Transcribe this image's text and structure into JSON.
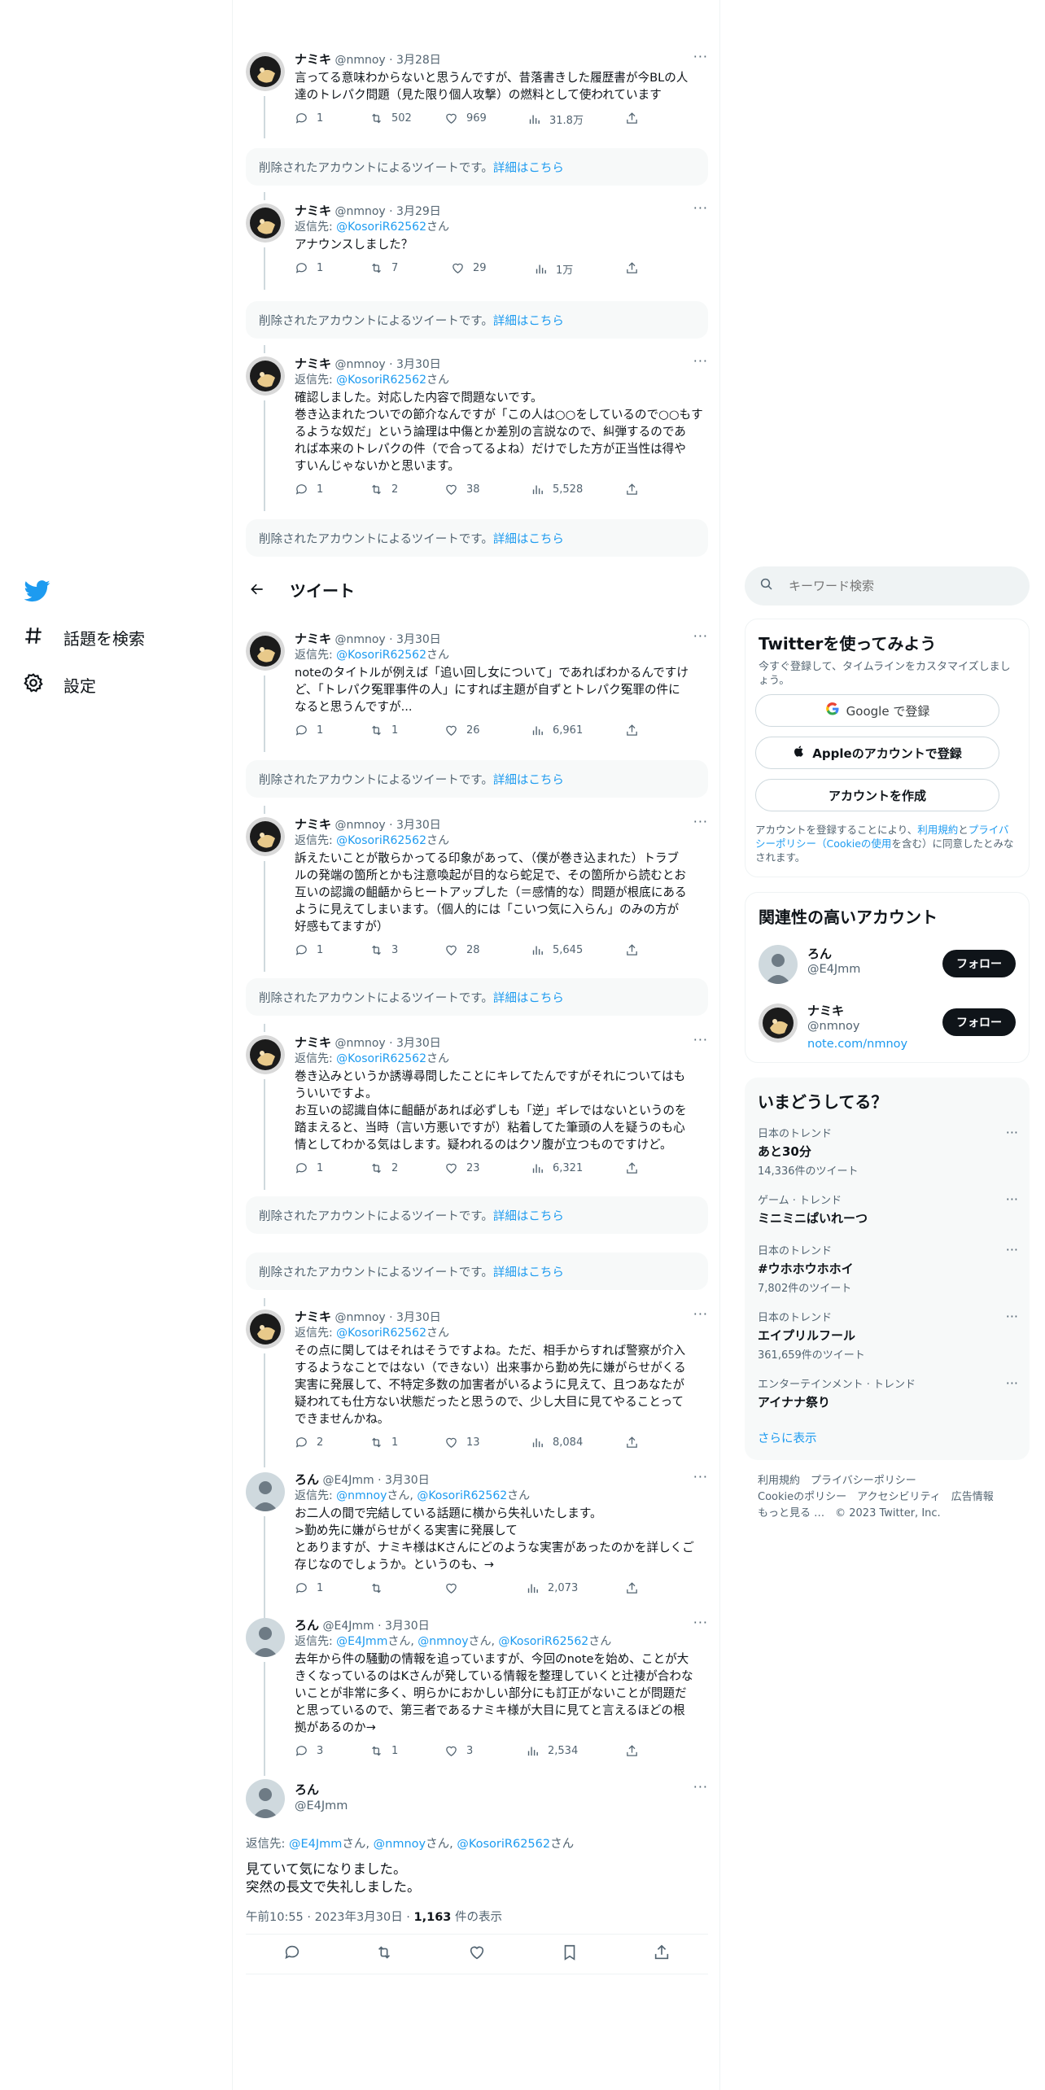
{
  "nav": {
    "explore": "話題を検索",
    "settings": "設定"
  },
  "header": {
    "title": "ツイート"
  },
  "deleted_text": "削除されたアカウントによるツイートです。",
  "deleted_link": "詳細はこちら",
  "tweets": [
    {
      "name": "ナミキ",
      "meta": "@nmnoy · 3月28日",
      "reply_to": "",
      "reply_suffix": "",
      "text": "言ってる意味わからないと思うんですが、昔落書きした履歴書が今BLの人\n達のトレパク問題（見た限り個人攻撃）の燃料として使われています",
      "replies": "1",
      "retweets": "502",
      "likes": "969",
      "views": "31.8万"
    },
    {
      "name": "ナミキ",
      "meta": "@nmnoy · 3月29日",
      "reply_to": "@KosoriR62562",
      "reply_suffix": "さん",
      "text": "アナウンスしました？",
      "replies": "1",
      "retweets": "7",
      "likes": "29",
      "views": "1万"
    },
    {
      "name": "ナミキ",
      "meta": "@nmnoy · 3月30日",
      "reply_to": "@KosoriR62562",
      "reply_suffix": "さん",
      "text": "確認しました。対応した内容で問題ないです。\n巻き込まれたついでの節介なんですが「この人は○○をしているので○○もす\nるような奴だ」という論理は中傷とか差別の言説なので、糾弾するのであ\nれば本来のトレパクの件（で合ってるよね）だけでした方が正当性は得や\nすいんじゃないかと思います。",
      "replies": "1",
      "retweets": "2",
      "likes": "38",
      "views": "5,528"
    },
    {
      "name": "ナミキ",
      "meta": "@nmnoy · 3月30日",
      "reply_to": "@KosoriR62562",
      "reply_suffix": "さん",
      "text": "noteのタイトルが例えば「追い回し女について」であればわかるんですけ\nど、「トレパク冤罪事件の人」にすれば主題が自ずとトレパク冤罪の件に\nなると思うんですが...",
      "replies": "1",
      "retweets": "1",
      "likes": "26",
      "views": "6,961"
    },
    {
      "name": "ナミキ",
      "meta": "@nmnoy · 3月30日",
      "reply_to": "@KosoriR62562",
      "reply_suffix": "さん",
      "text": "訴えたいことが散らかってる印象があって、（僕が巻き込まれた）トラブ\nルの発端の箇所とかも注意喚起が目的なら蛇足で、その箇所から読むとお\n互いの認識の齟齬からヒートアップした（＝感情的な）問題が根底にある\nように見えてしまいます。（個人的には「こいつ気に入らん」のみの方が\n好感もてますが）",
      "replies": "1",
      "retweets": "3",
      "likes": "28",
      "views": "5,645"
    },
    {
      "name": "ナミキ",
      "meta": "@nmnoy · 3月30日",
      "reply_to": "@KosoriR62562",
      "reply_suffix": "さん",
      "text": "巻き込みというか誘導尋問したことにキレてたんですがそれについてはも\nういいですよ。\nお互いの認識自体に齟齬があれば必ずしも「逆」ギレではないというのを\n踏まえると、当時（言い方悪いですが）粘着してた筆頭の人を疑うのも心\n情としてわかる気はします。疑われるのはクソ腹が立つものですけど。",
      "replies": "1",
      "retweets": "2",
      "likes": "23",
      "views": "6,321"
    },
    {
      "name": "ナミキ",
      "meta": "@nmnoy · 3月30日",
      "reply_to": "@KosoriR62562",
      "reply_suffix": "さん",
      "text": "その点に関してはそれはそうですよね。ただ、相手からすれば警察が介入\nするようなことではない（できない）出来事から勤め先に嫌がらせがくる\n実害に発展して、不特定多数の加害者がいるように見えて、且つあなたが\n疑われても仕方ない状態だったと思うので、少し大目に見てやることって\nできませんかね。",
      "replies": "2",
      "retweets": "1",
      "likes": "13",
      "views": "8,084"
    },
    {
      "name": "ろん",
      "meta": "@E4Jmm · 3月30日",
      "reply_to": "@nmnoy",
      "reply_suffix": "さん, ",
      "reply_to2": "@KosoriR62562",
      "reply_suffix2": "さん",
      "text": "お二人の間で完結している話題に横から失礼いたします。\n>勤め先に嫌がらせがくる実害に発展して\nとありますが、ナミキ様はKさんにどのような実害があったのかを詳しくご\n存じなのでしょうか。というのも、→",
      "replies": "1",
      "retweets": "",
      "likes": "",
      "views": "2,073"
    },
    {
      "name": "ろん",
      "meta": "@E4Jmm · 3月30日",
      "reply_to": "@E4Jmm",
      "reply_suffix": "さん, ",
      "reply_to2": "@nmnoy",
      "reply_suffix2": "さん, ",
      "reply_to3": "@KosoriR62562",
      "reply_suffix3": "さん",
      "text": "去年から件の騒動の情報を追っていますが、今回のnoteを始め、ことが大\nきくなっているのはKさんが発している情報を整理していくと辻褄が合わな\nいことが非常に多く、明らかにおかしい部分にも訂正がないことが問題だ\nと思っているので、第三者であるナミキ様が大目に見てと言えるほどの根\n拠があるのか→",
      "replies": "3",
      "retweets": "1",
      "likes": "3",
      "views": "2,534"
    }
  ],
  "focused": {
    "name": "ろん",
    "handle": "@E4Jmm",
    "reply_prefix": "返信先: ",
    "reply_to": "@E4Jmm",
    "s1": "さん, ",
    "reply_to2": "@nmnoy",
    "s2": "さん, ",
    "reply_to3": "@KosoriR62562",
    "s3": "さん",
    "text": "見ていて気になりました。\n突然の長文で失礼しました。",
    "time": "午前10:55 · 2023年3月30日 · ",
    "views_count": "1,163",
    "views_label": " 件の表示"
  },
  "reply_prefix": "返信先: ",
  "sidebar": {
    "search_placeholder": "キーワード検索",
    "signup": {
      "title": "Twitterを使ってみよう",
      "subtitle": "今すぐ登録して、タイムラインをカスタマイズしましょう。",
      "google": "Google で登録",
      "apple": "Appleのアカウントで登録",
      "create": "アカウントを作成",
      "terms_1": "アカウントを登録することにより、",
      "terms_link1": "利用規約",
      "terms_2": "と",
      "terms_link2": "プライバシーポリシー（Cookieの使用",
      "terms_3": "を含む）に同意したとみなされます。"
    },
    "related": {
      "title": "関連性の高いアカウント",
      "accounts": [
        {
          "name": "ろん",
          "handle": "@E4Jmm",
          "link": "",
          "follow": "フォロー"
        },
        {
          "name": "ナミキ",
          "handle": "@nmnoy",
          "link": "note.com/nmnoy",
          "follow": "フォロー"
        }
      ]
    },
    "trends": {
      "title": "いまどうしてる？",
      "items": [
        {
          "category": "日本のトレンド",
          "name": "あと30分",
          "count": "14,336件のツイート"
        },
        {
          "category": "ゲーム · トレンド",
          "name": "ミニミニぱいれーつ",
          "count": ""
        },
        {
          "category": "日本のトレンド",
          "name": "#ウホホウホホイ",
          "count": "7,802件のツイート"
        },
        {
          "category": "日本のトレンド",
          "name": "エイプリルフール",
          "count": "361,659件のツイート"
        },
        {
          "category": "エンターテインメント · トレンド",
          "name": "アイナナ祭り",
          "count": ""
        }
      ],
      "show_more": "さらに表示"
    },
    "footer": {
      "line1": "利用規約　プライバシーポリシー",
      "line2": "Cookieのポリシー　アクセシビリティ　広告情報",
      "line3": "もっと見る …　© 2023 Twitter, Inc."
    }
  }
}
